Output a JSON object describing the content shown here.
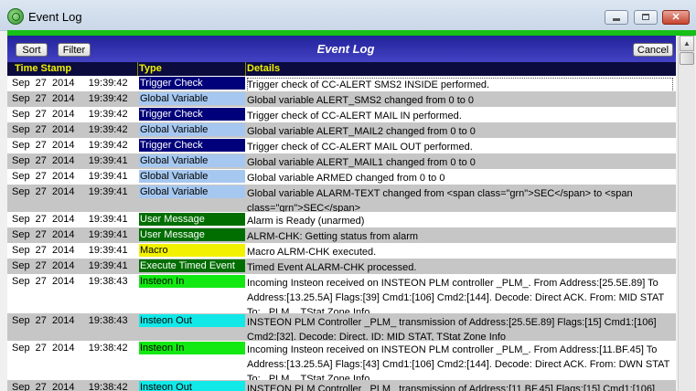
{
  "window": {
    "title": "Event Log",
    "icon": "insteon-globe-icon"
  },
  "toolbar": {
    "sort_label": "Sort",
    "filter_label": "Filter",
    "title": "Event Log",
    "cancel_label": "Cancel"
  },
  "columns": {
    "timestamp": "Time Stamp",
    "type": "Type",
    "details": "Details"
  },
  "type_colors": {
    "Trigger Check": {
      "bg": "#00007a",
      "fg": "#ffffff"
    },
    "Global Variable": {
      "bg": "#a6c8f0",
      "fg": "#000000"
    },
    "User Message": {
      "bg": "#006e00",
      "fg": "#ffffff"
    },
    "Macro": {
      "bg": "#f2f200",
      "fg": "#000000"
    },
    "Execute Timed Event": {
      "bg": "#006e00",
      "fg": "#ffffff"
    },
    "Insteon In": {
      "bg": "#12e812",
      "fg": "#000000"
    },
    "Insteon Out": {
      "bg": "#12e8e8",
      "fg": "#000000"
    }
  },
  "rows": [
    {
      "ts": "Sep  27  2014     19:39:42",
      "type": "Trigger Check",
      "details": "Trigger check of CC-ALERT SMS2 INSIDE performed."
    },
    {
      "ts": "Sep  27  2014     19:39:42",
      "type": "Global Variable",
      "details": "Global variable ALERT_SMS2 changed from 0 to 0"
    },
    {
      "ts": "Sep  27  2014     19:39:42",
      "type": "Trigger Check",
      "details": "Trigger check of CC-ALERT MAIL IN performed."
    },
    {
      "ts": "Sep  27  2014     19:39:42",
      "type": "Global Variable",
      "details": "Global variable ALERT_MAIL2 changed from 0 to 0"
    },
    {
      "ts": "Sep  27  2014     19:39:42",
      "type": "Trigger Check",
      "details": "Trigger check of CC-ALERT MAIL OUT performed."
    },
    {
      "ts": "Sep  27  2014     19:39:41",
      "type": "Global Variable",
      "details": "Global variable ALERT_MAIL1 changed from 0 to 0"
    },
    {
      "ts": "Sep  27  2014     19:39:41",
      "type": "Global Variable",
      "details": "Global variable ARMED changed from 0 to 0"
    },
    {
      "ts": "Sep  27  2014     19:39:41",
      "type": "Global Variable",
      "details": "Global variable ALARM-TEXT changed from  <span class=\"grn\">SEC</span>  to  <span class=\"grn\">SEC</span>"
    },
    {
      "ts": "Sep  27  2014     19:39:41",
      "type": "User Message",
      "details": "Alarm is Ready (unarmed)"
    },
    {
      "ts": "Sep  27  2014     19:39:41",
      "type": "User Message",
      "details": "ALRM-CHK: Getting status from alarm"
    },
    {
      "ts": "Sep  27  2014     19:39:41",
      "type": "Macro",
      "details": "Macro ALRM-CHK executed."
    },
    {
      "ts": "Sep  27  2014     19:39:41",
      "type": "Execute Timed Event",
      "details": "Timed Event ALARM-CHK processed."
    },
    {
      "ts": "Sep  27  2014     19:38:43",
      "type": "Insteon In",
      "details": "Incoming Insteon received on INSTEON PLM controller _PLM_. From Address:[25.5E.89] To Address:[13.25.5A] Flags:[39] Cmd1:[106] Cmd2:[144].  Decode: Direct ACK. From: MID STAT To: _PLM_, TStat Zone Info"
    },
    {
      "ts": "Sep  27  2014     19:38:43",
      "type": "Insteon Out",
      "details": "INSTEON PLM Controller _PLM_ transmission of Address:[25.5E.89] Flags:[15] Cmd1:[106] Cmd2:[32].  Decode: Direct. ID: MID STAT, TStat Zone Info"
    },
    {
      "ts": "Sep  27  2014     19:38:42",
      "type": "Insteon In",
      "details": "Incoming Insteon received on INSTEON PLM controller _PLM_. From Address:[11.BF.45] To Address:[13.25.5A] Flags:[43] Cmd1:[106] Cmd2:[144].  Decode: Direct ACK. From: DWN STAT To: _PLM_, TStat Zone Info"
    },
    {
      "ts": "Sep  27  2014     19:38:42",
      "type": "Insteon Out",
      "details": "INSTEON PLM Controller _PLM_ transmission of Address:[11.BF.45] Flags:[15] Cmd1:[106]"
    }
  ]
}
